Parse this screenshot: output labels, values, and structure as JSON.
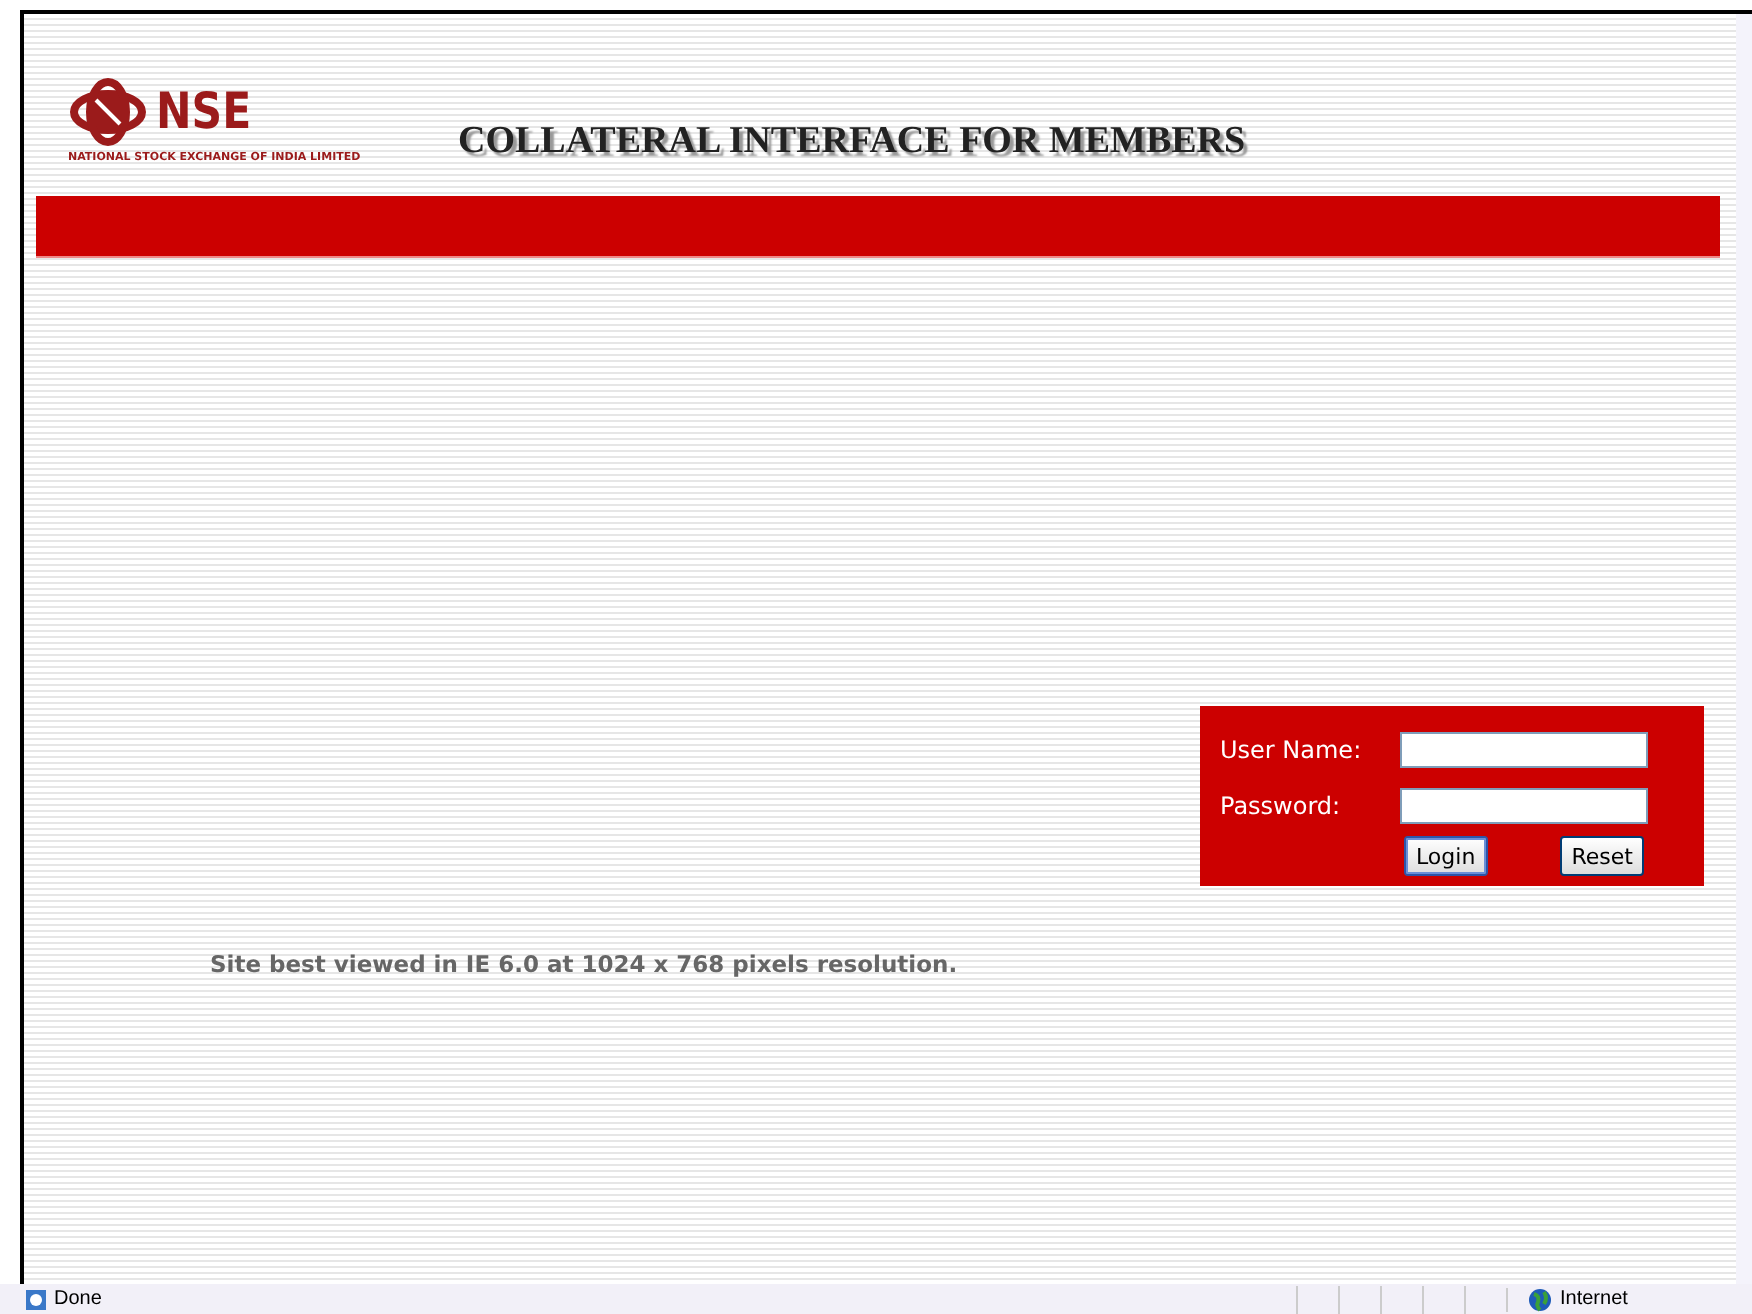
{
  "header": {
    "logo_text": "NSE",
    "logo_caption": "NATIONAL STOCK EXCHANGE OF INDIA LIMITED",
    "title": "COLLATERAL INTERFACE FOR MEMBERS"
  },
  "login": {
    "fields": [
      {
        "label": "User Name:"
      },
      {
        "label": "Password:"
      }
    ],
    "buttons": [
      {
        "label": "Login",
        "focused": true
      },
      {
        "label": "Reset",
        "focused": false
      }
    ]
  },
  "note": "Site best viewed in IE 6.0 at 1024 x 768 pixels resolution.",
  "status_bar": {
    "text": "Done",
    "zone": "Internet"
  }
}
